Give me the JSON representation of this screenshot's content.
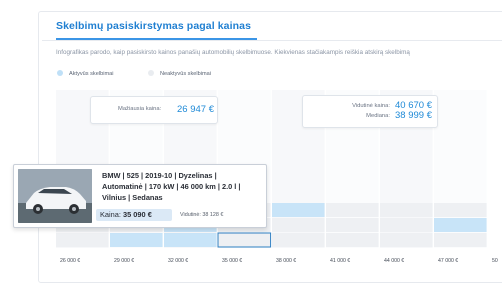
{
  "title": "Skelbimų pasiskirstymas pagal kainas",
  "subtitle": "Infografikas parodo, kaip pasiskirsto kainos panašių automobilių skelbimuose. Kiekvienas stačiakampis reiškia atskirą skelbimą",
  "legend": {
    "active": "Aktyvūs skelbimai",
    "inactive": "Neaktyvūs skelbimai"
  },
  "colors": {
    "accent": "#1f7fd1",
    "active_dot": "#bfe0f7",
    "inactive_dot": "#e9ecf0",
    "active_cell": "#c8e4f8",
    "inactive_cell": "#eef0f3",
    "highlight_cell": "#2e7fc2"
  },
  "callouts": {
    "min_label": "Mažiausia kaina:",
    "min_value": "26 947 €",
    "avg_label": "Vidutinė kaina:",
    "avg_value": "40 670 €",
    "median_label": "Mediana:",
    "median_value": "38 999 €"
  },
  "tooltip": {
    "line1": "BMW | 525 | 2019-10 | Dyzelinas |",
    "line2": "Automatinė | 170 kW | 46 000 km | 2.0 l |",
    "line3": "Vilnius | Sedanas",
    "price_label": "Kaina:",
    "price_value": "35 090 €",
    "avg_text": "Vidutinė: 38 128 €",
    "image_icon": "car-photo-icon"
  },
  "chart_data": {
    "type": "histogram",
    "xlabel": "",
    "ylabel": "",
    "x_ticks": [
      "26 000 €",
      "29 000 €",
      "32 000 €",
      "35 000 €",
      "38 000 €",
      "41 000 €",
      "44 000 €",
      "47 000 €",
      "50"
    ],
    "columns": [
      {
        "bin_start": 26000,
        "cells": [
          "inactive",
          "inactive",
          "inactive"
        ]
      },
      {
        "bin_start": 29000,
        "cells": [
          "active",
          "inactive",
          "inactive"
        ]
      },
      {
        "bin_start": 32000,
        "cells": [
          "active",
          "active",
          "inactive"
        ]
      },
      {
        "bin_start": 35000,
        "cells": [
          "highlight",
          "inactive",
          "inactive"
        ]
      },
      {
        "bin_start": 38000,
        "cells": [
          "inactive",
          "inactive",
          "active"
        ]
      },
      {
        "bin_start": 41000,
        "cells": [
          "inactive",
          "inactive",
          "inactive"
        ]
      },
      {
        "bin_start": 44000,
        "cells": [
          "inactive",
          "inactive",
          "inactive"
        ]
      },
      {
        "bin_start": 47000,
        "cells": [
          "inactive",
          "active",
          "inactive"
        ]
      }
    ]
  }
}
